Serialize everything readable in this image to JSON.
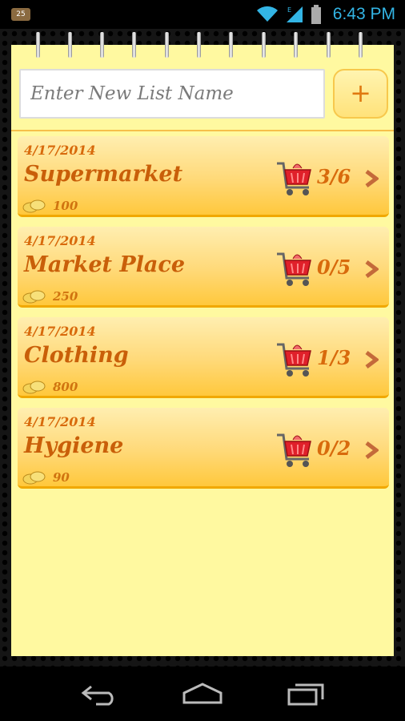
{
  "status_bar": {
    "notification_badge": "25",
    "time": "6:43 PM",
    "icons": [
      "notification-icon",
      "wifi-icon",
      "signal-icon",
      "battery-icon"
    ]
  },
  "new_list": {
    "placeholder": "Enter New List Name",
    "value": "",
    "add_label": "+"
  },
  "lists": [
    {
      "date": "4/17/2014",
      "name": "Supermarket",
      "count": "3/6",
      "budget": "100"
    },
    {
      "date": "4/17/2014",
      "name": "Market Place",
      "count": "0/5",
      "budget": "250"
    },
    {
      "date": "4/17/2014",
      "name": "Clothing",
      "count": "1/3",
      "budget": "800"
    },
    {
      "date": "4/17/2014",
      "name": "Hygiene",
      "count": "0/2",
      "budget": "90"
    }
  ],
  "nav_bar": {
    "icons": [
      "back-icon",
      "home-icon",
      "recent-apps-icon"
    ]
  },
  "colors": {
    "accent": "#d86a0c",
    "paper": "#fff9a0",
    "card_top": "#ffeeb0",
    "card_bottom": "#ffc83c",
    "clock": "#33b5e5"
  }
}
